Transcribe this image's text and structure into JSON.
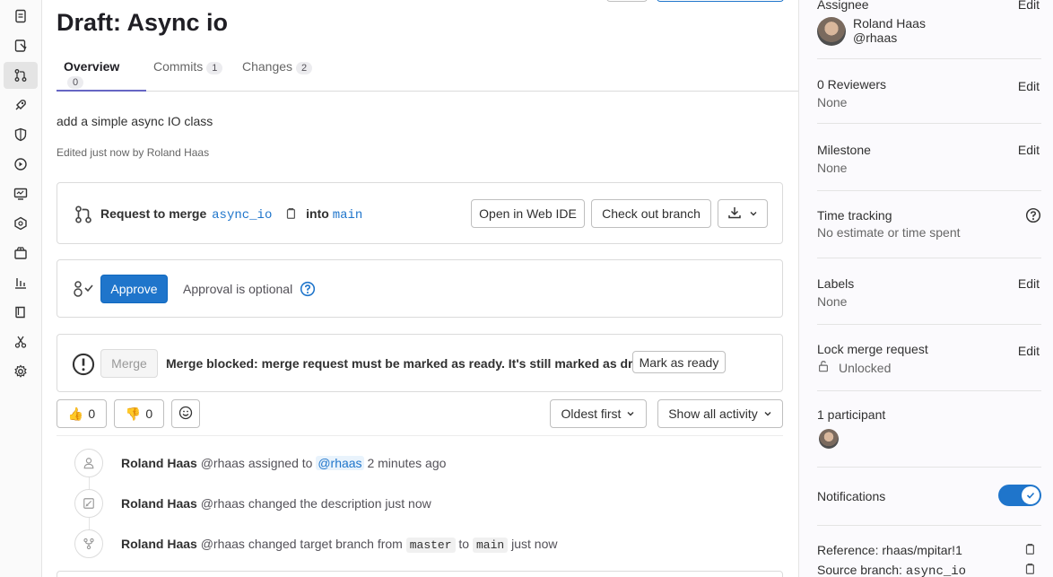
{
  "rail": {
    "items": [
      "issues-icon",
      "merge-request-list-icon",
      "merge-requests-icon",
      "deployments-icon",
      "security-icon",
      "operations-icon",
      "monitor-icon",
      "infrastructure-icon",
      "packages-icon",
      "analytics-icon",
      "wiki-icon",
      "snippets-icon",
      "settings-icon"
    ],
    "active_index": 2
  },
  "mr": {
    "title": "Draft: Async io",
    "tabs": [
      {
        "label": "Overview",
        "count": "0"
      },
      {
        "label": "Commits",
        "count": "1"
      },
      {
        "label": "Changes",
        "count": "2"
      }
    ],
    "description": "add a simple async IO class",
    "edited": "Edited just now by Roland Haas"
  },
  "merge_info": {
    "prefix": "Request to merge",
    "source": "async_io",
    "into": "into",
    "target": "main",
    "open_ide": "Open in Web IDE",
    "checkout": "Check out branch"
  },
  "approval": {
    "approve_label": "Approve",
    "optional_text": "Approval is optional"
  },
  "merge": {
    "merge_label": "Merge",
    "blocked_text": "Merge blocked: merge request must be marked as ready. It's still marked as draft.",
    "ready_label": "Mark as ready"
  },
  "reactions": {
    "thumbs_up": "👍",
    "thumbs_up_count": "0",
    "thumbs_down": "👎",
    "thumbs_down_count": "0"
  },
  "filters": {
    "sort": "Oldest first",
    "activity": "Show all activity"
  },
  "activity": [
    {
      "author": "Roland Haas",
      "handle": "@rhaas",
      "pre": "assigned to",
      "mention": "@rhaas",
      "time": "2 minutes ago"
    },
    {
      "author": "Roland Haas",
      "handle": "@rhaas",
      "text": "changed the description just now"
    },
    {
      "author": "Roland Haas",
      "handle": "@rhaas",
      "pre": "changed target branch from",
      "from": "master",
      "to_word": "to",
      "to": "main",
      "time": "just now"
    }
  ],
  "sidebar": {
    "assignee_title": "Assignee",
    "assignee_name": "Roland Haas",
    "assignee_handle": "@rhaas",
    "edit": "Edit",
    "reviewers_title": "0 Reviewers",
    "reviewers_value": "None",
    "milestone_title": "Milestone",
    "milestone_value": "None",
    "time_title": "Time tracking",
    "time_value": "No estimate or time spent",
    "labels_title": "Labels",
    "labels_value": "None",
    "lock_title": "Lock merge request",
    "lock_value": "Unlocked",
    "participants_title": "1 participant",
    "notifications_title": "Notifications",
    "notifications_on": true,
    "reference": "Reference: rhaas/mpitar!1",
    "source_branch_label": "Source branch:",
    "source_branch_value": "async_io"
  },
  "colors": {
    "accent": "#1f75cb",
    "tab_underline": "#6666c4"
  }
}
